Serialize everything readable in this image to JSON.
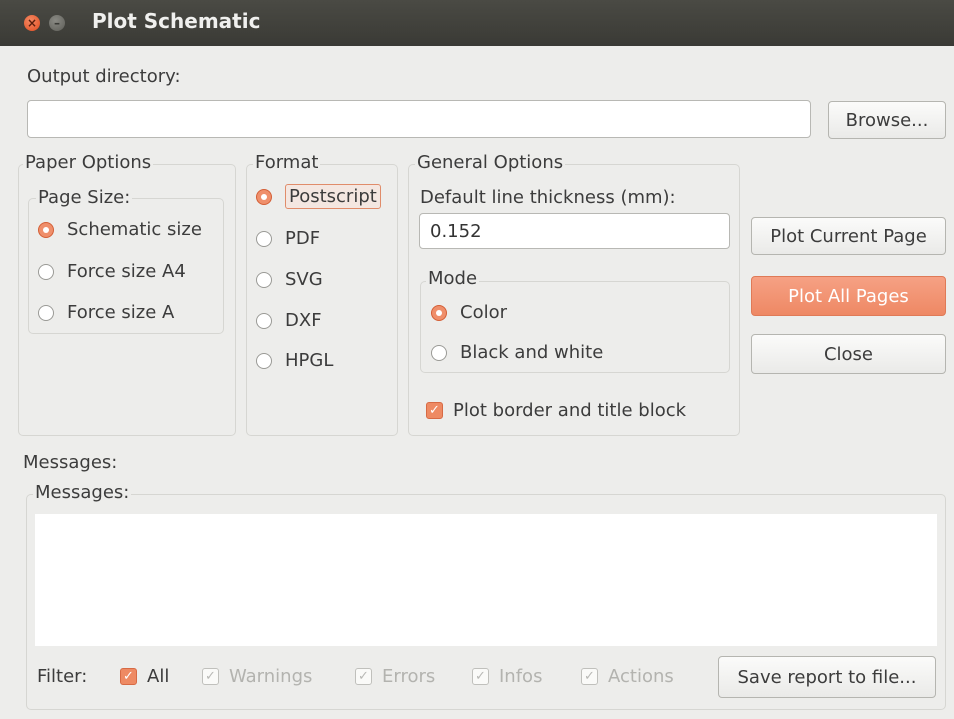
{
  "window": {
    "title": "Plot Schematic"
  },
  "output_directory": {
    "label": "Output directory:",
    "value": "",
    "browse_label": "Browse..."
  },
  "paper_options": {
    "title": "Paper Options",
    "page_size_title": "Page Size:",
    "options": [
      "Schematic size",
      "Force size A4",
      "Force size A"
    ],
    "selected": "Schematic size"
  },
  "format": {
    "title": "Format",
    "options": [
      "Postscript",
      "PDF",
      "SVG",
      "DXF",
      "HPGL"
    ],
    "selected": "Postscript"
  },
  "general_options": {
    "title": "General Options",
    "line_thickness_label": "Default line thickness (mm):",
    "line_thickness_value": "0.152",
    "mode_title": "Mode",
    "mode_options": [
      "Color",
      "Black and white"
    ],
    "mode_selected": "Color",
    "plot_border_label": "Plot border and title block",
    "plot_border_checked": true
  },
  "actions": {
    "plot_current": "Plot Current Page",
    "plot_all": "Plot All Pages",
    "close": "Close"
  },
  "messages": {
    "label": "Messages:",
    "group_title": "Messages:",
    "filter_label": "Filter:",
    "filters": [
      {
        "label": "All",
        "checked": true,
        "enabled": true
      },
      {
        "label": "Warnings",
        "checked": true,
        "enabled": false
      },
      {
        "label": "Errors",
        "checked": true,
        "enabled": false
      },
      {
        "label": "Infos",
        "checked": true,
        "enabled": false
      },
      {
        "label": "Actions",
        "checked": true,
        "enabled": false
      }
    ],
    "save_report": "Save report to file..."
  },
  "colors": {
    "accent": "#ee8a63",
    "titlebar": "#3f3f3a",
    "background": "#ededeb"
  }
}
